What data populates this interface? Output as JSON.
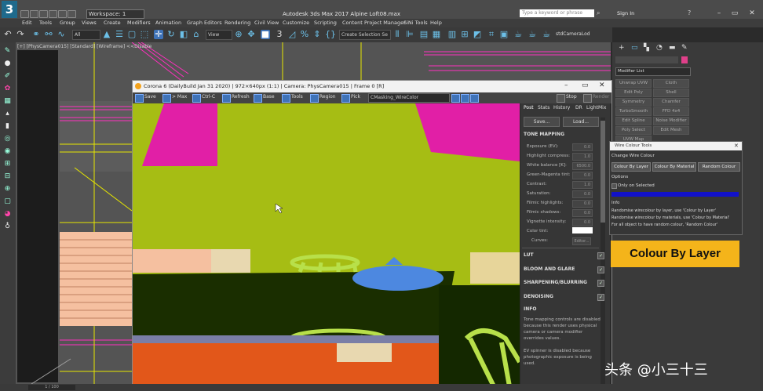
{
  "app": {
    "title": "Autodesk 3ds Max 2017   Alpine Loft08.max",
    "logo": "3",
    "workspace": "Workspace: 1",
    "search_placeholder": "Type a keyword or phrase",
    "sign_in": "Sign In",
    "menu": [
      "Edit",
      "Tools",
      "Group",
      "Views",
      "Create",
      "Modifiers",
      "Animation",
      "Graph Editors",
      "Rendering",
      "Civil View",
      "Customize",
      "Scripting",
      "Content",
      "Project Manager",
      "SiNi Tools",
      "Help"
    ],
    "toolbar_dropdowns": {
      "selection_filter": "All",
      "view": "View",
      "create_selection_set": "Create Selection Se",
      "camera": "stdCameraLod"
    },
    "viewport_label": "[+] [PhysCamera015] [Standard] [Wireframe]  <<Disable"
  },
  "frame_buffer": {
    "title": "Corona 6 (DailyBuild Jan 31 2020) | 972×640px (1:1) | Camera: PhysCamera015 | Frame 0 [R]",
    "toolbar": {
      "save": "Save",
      "max": "> Max",
      "ctrl_c": "Ctrl-C",
      "refresh": "Refresh",
      "base": "Base",
      "tools": "Tools",
      "region": "Region",
      "pick": "Pick",
      "channel": "CMasking_WireColor",
      "stop": "Stop",
      "render": "Render"
    },
    "tabs": [
      "Post",
      "Stats",
      "History",
      "DR",
      "LightMix"
    ],
    "buttons": {
      "save": "Save...",
      "load": "Load..."
    },
    "tone_mapping": {
      "header": "TONE MAPPING",
      "rows": [
        {
          "label": "Exposure (EV):",
          "value": "0.0"
        },
        {
          "label": "Highlight compress:",
          "value": "1.0"
        },
        {
          "label": "White balance [K]:",
          "value": "6500.0"
        },
        {
          "label": "Green-Magenta tint:",
          "value": "0.0"
        },
        {
          "label": "Contrast:",
          "value": "1.0"
        },
        {
          "label": "Saturation:",
          "value": "0.0"
        },
        {
          "label": "Filmic highlights:",
          "value": "0.0"
        },
        {
          "label": "Filmic shadows:",
          "value": "0.0"
        },
        {
          "label": "Vignette intensity:",
          "value": "0.0"
        }
      ],
      "color_tint_label": "Color tint:",
      "curves_label": "Curves:",
      "curves_button": "Editor..."
    },
    "sections": [
      "LUT",
      "BLOOM AND GLARE",
      "SHARPENING/BLURRING",
      "DENOISING"
    ],
    "info_header": "INFO",
    "info_text_1": "Tone mapping controls are disabled because this render uses physical camera or camera modifier overrides values.",
    "info_text_2": "EV spinner is disabled because photographic exposure is being used."
  },
  "command_panel": {
    "modifier_list": "Modifier List",
    "buttons": [
      "Unwrap UVW",
      "Cloth",
      "Edit Poly",
      "Shell",
      "Symmetry",
      "Chamfer",
      "TurboSmooth",
      "FFD 4x4",
      "Edit Spline",
      "Noise Modifier",
      "Poly Select",
      "Edit Mesh",
      "UVW Map"
    ]
  },
  "wire_colour_tools": {
    "title": "Wire Colour Tools",
    "section": "Change Wire Colour",
    "buttons": [
      "Colour By Layer",
      "Colour By Material",
      "Random Colour"
    ],
    "options_label": "Options",
    "only_selected": "Only on Selected",
    "info_label": "Info",
    "info_lines": [
      "Randomise wirecolour by layer, use 'Colour by Layer'",
      "Randomise wirecolour by materials, use 'Colour by Material'",
      "For all object to have random colour, 'Random Colour'"
    ]
  },
  "callout": "Colour By Layer",
  "watermark": "头条 @小三十三",
  "status": {
    "coord": "1 / 100"
  },
  "colors": {
    "accent": "#3f73b8",
    "callout": "#f4b41a",
    "render_green": "#a6bd14",
    "magenta": "#e11fa6",
    "orange": "#e2571a",
    "lime": "#b8e04a",
    "blue": "#4d88e0"
  }
}
